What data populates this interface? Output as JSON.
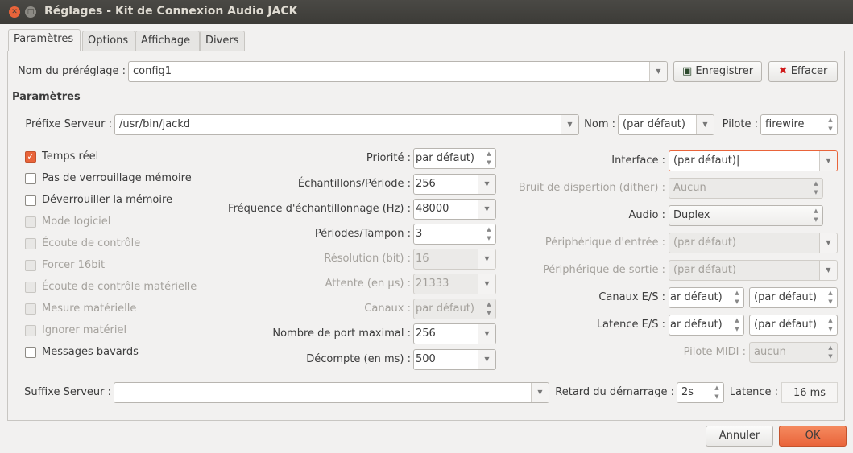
{
  "window": {
    "title": "Réglages - Kit de Connexion Audio JACK"
  },
  "tabs": [
    "Paramètres",
    "Options",
    "Affichage",
    "Divers"
  ],
  "preset": {
    "label": "Nom du préréglage :",
    "value": "config1",
    "save": "Enregistrer",
    "clear": "Effacer"
  },
  "section": "Paramètres",
  "server_prefix": {
    "label": "Préfixe Serveur :",
    "value": "/usr/bin/jackd"
  },
  "name": {
    "label": "Nom :",
    "value": "(par défaut)"
  },
  "driver": {
    "label": "Pilote :",
    "value": "firewire"
  },
  "checkboxes": [
    {
      "label": "Temps réel",
      "checked": true,
      "enabled": true
    },
    {
      "label": "Pas de verrouillage mémoire",
      "checked": false,
      "enabled": true
    },
    {
      "label": "Déverrouiller la mémoire",
      "checked": false,
      "enabled": true
    },
    {
      "label": "Mode logiciel",
      "checked": false,
      "enabled": false
    },
    {
      "label": "Écoute de contrôle",
      "checked": false,
      "enabled": false
    },
    {
      "label": "Forcer 16bit",
      "checked": false,
      "enabled": false
    },
    {
      "label": "Écoute de contrôle matérielle",
      "checked": false,
      "enabled": false
    },
    {
      "label": "Mesure matérielle",
      "checked": false,
      "enabled": false
    },
    {
      "label": "Ignorer matériel",
      "checked": false,
      "enabled": false
    },
    {
      "label": "Messages bavards",
      "checked": false,
      "enabled": true
    }
  ],
  "middle": [
    {
      "label": "Priorité :",
      "value": "par défaut)",
      "type": "spin",
      "enabled": true
    },
    {
      "label": "Échantillons/Période :",
      "value": "256",
      "type": "combo",
      "enabled": true
    },
    {
      "label": "Fréquence d'échantillonnage (Hz) :",
      "value": "48000",
      "type": "combo",
      "enabled": true
    },
    {
      "label": "Périodes/Tampon :",
      "value": "3",
      "type": "spin",
      "enabled": true
    },
    {
      "label": "Résolution (bit) :",
      "value": "16",
      "type": "combo",
      "enabled": false
    },
    {
      "label": "Attente (en µs) :",
      "value": "21333",
      "type": "combo",
      "enabled": false
    },
    {
      "label": "Canaux :",
      "value": "par défaut)",
      "type": "spin",
      "enabled": false
    },
    {
      "label": "Nombre de port maximal :",
      "value": "256",
      "type": "combo",
      "enabled": true
    },
    {
      "label": "Décompte (en ms) :",
      "value": "500",
      "type": "combo",
      "enabled": true
    }
  ],
  "right": {
    "interface": {
      "label": "Interface :",
      "value": "(par défaut)"
    },
    "dither": {
      "label": "Bruit de dispertion (dither) :",
      "value": "Aucun"
    },
    "audio": {
      "label": "Audio :",
      "value": "Duplex"
    },
    "input_device": {
      "label": "Périphérique d'entrée :",
      "value": "(par défaut)"
    },
    "output_device": {
      "label": "Périphérique de sortie :",
      "value": "(par défaut)"
    },
    "channels_io": {
      "label": "Canaux E/S :",
      "in": "ar défaut)",
      "out": "(par défaut)"
    },
    "latency_io": {
      "label": "Latence E/S :",
      "in": "ar défaut)",
      "out": "(par défaut)"
    },
    "midi_driver": {
      "label": "Pilote MIDI :",
      "value": "aucun"
    }
  },
  "bottom": {
    "suffix_label": "Suffixe Serveur :",
    "suffix_value": "",
    "start_delay_label": "Retard du démarrage :",
    "start_delay": "2s",
    "latency_label": "Latence :",
    "latency": "16 ms"
  },
  "buttons": {
    "cancel": "Annuler",
    "ok": "OK"
  }
}
